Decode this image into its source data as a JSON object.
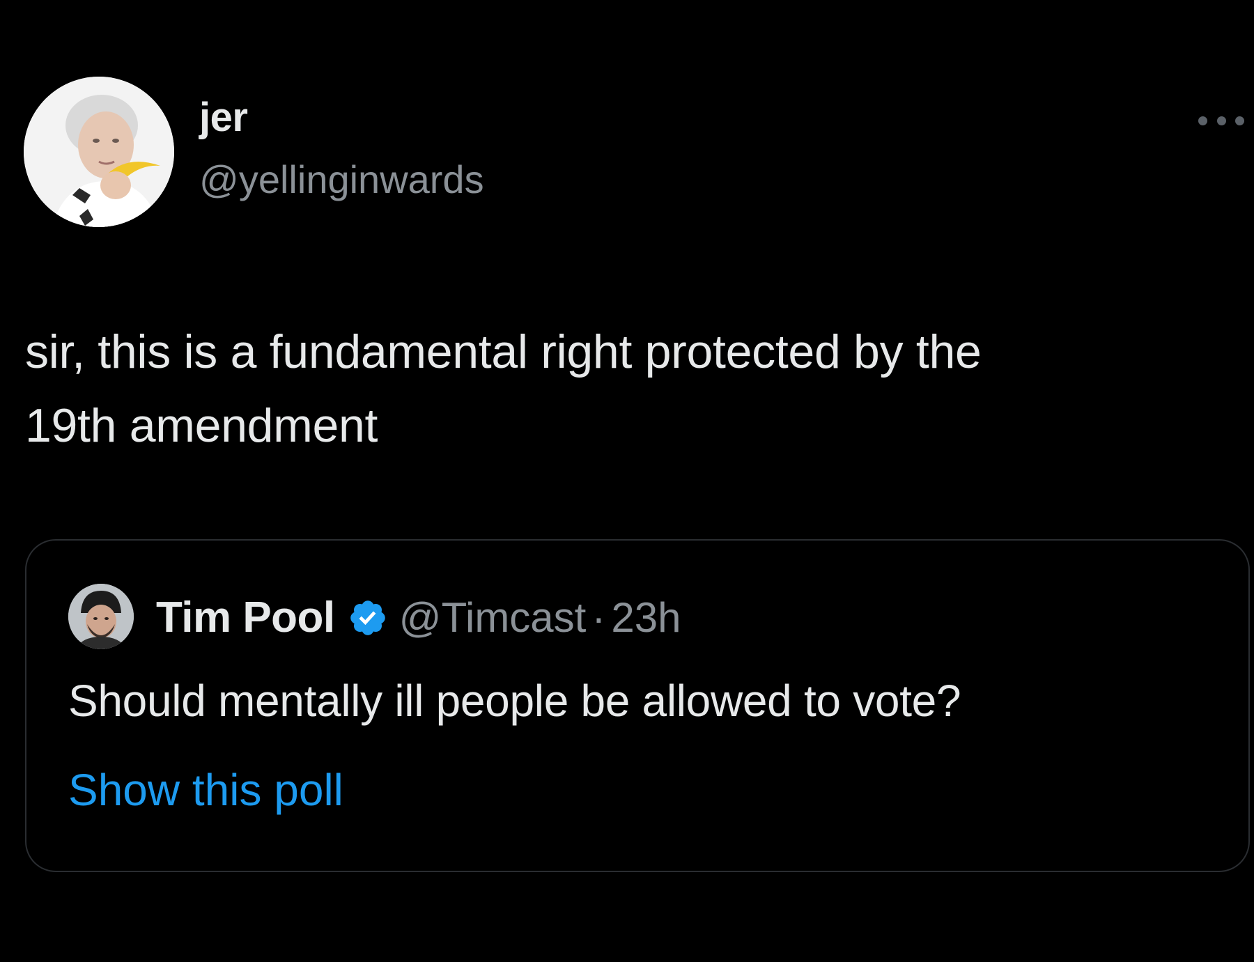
{
  "tweet": {
    "author": {
      "display_name": "jer",
      "handle": "@yellinginwards"
    },
    "text_line1": "sir, this is a fundamental right protected by the",
    "text_line2": "19th amendment",
    "more_icon": "more-horizontal-icon"
  },
  "quote": {
    "author": {
      "display_name": "Tim Pool",
      "handle": "@Timcast",
      "separator": "·",
      "time": "23h",
      "verified": true,
      "verified_icon": "verified-badge-icon"
    },
    "text": "Should mentally ill people be allowed to vote?",
    "show_poll_label": "Show this poll"
  },
  "colors": {
    "background": "#000000",
    "text_primary": "#e7e9ea",
    "text_secondary": "#8b9197",
    "link": "#1d9bf0",
    "verified": "#1d9bf0",
    "border": "#2a2d31"
  }
}
